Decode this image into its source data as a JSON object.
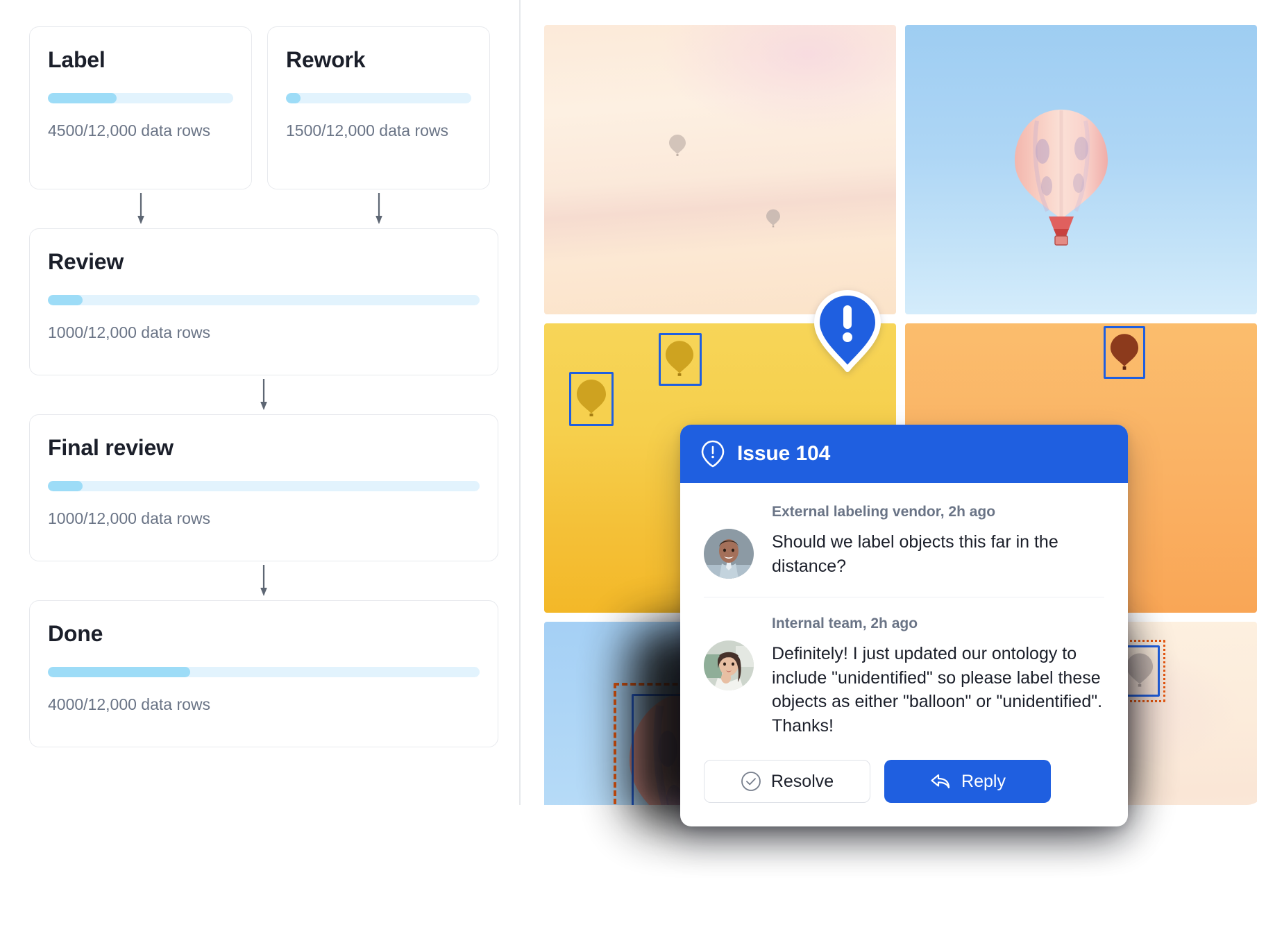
{
  "workflow": {
    "stages": [
      {
        "id": "label",
        "title": "Label",
        "completed": 4500,
        "total": "12,000",
        "progress_pct": 37,
        "rows_label": "4500/12,000 data rows"
      },
      {
        "id": "rework",
        "title": "Rework",
        "completed": 1500,
        "total": "12,000",
        "progress_pct": 8,
        "rows_label": "1500/12,000 data rows"
      },
      {
        "id": "review",
        "title": "Review",
        "completed": 1000,
        "total": "12,000",
        "progress_pct": 8,
        "rows_label": "1000/12,000 data rows"
      },
      {
        "id": "final-review",
        "title": "Final review",
        "completed": 1000,
        "total": "12,000",
        "progress_pct": 8,
        "rows_label": "1000/12,000 data rows"
      },
      {
        "id": "done",
        "title": "Done",
        "completed": 4000,
        "total": "12,000",
        "progress_pct": 33,
        "rows_label": "4000/12,000 data rows"
      }
    ],
    "arrow_icon": "arrow-down-icon"
  },
  "gallery": {
    "tiles": [
      {
        "id": "tile-1",
        "description": "pale peach sunrise sky with two distant hot air balloons",
        "annotations": 0
      },
      {
        "id": "tile-2",
        "description": "light blue sky with pink and white striped hot air balloon",
        "annotations": 0
      },
      {
        "id": "tile-3",
        "description": "golden yellow sky with silhouetted balloons",
        "annotations": 2
      },
      {
        "id": "tile-4",
        "description": "orange sky with dark red hot air balloon",
        "annotations": 1
      },
      {
        "id": "tile-5",
        "description": "blue sky with large pink striped hot air balloon",
        "annotations": 2
      },
      {
        "id": "tile-6",
        "description": "cream sky with faint distant balloons",
        "annotations": 4
      }
    ],
    "box_color": "#1f5fe0",
    "dashed_box_color": "#e8570f"
  },
  "pin": {
    "icon": "issue-pin-exclamation-icon",
    "color": "#1f5fe0"
  },
  "dialog": {
    "icon": "issue-pin-icon",
    "title": "Issue 104",
    "accent_color": "#1f5fe0",
    "comments": [
      {
        "author_meta": "External labeling vendor, 2h ago",
        "avatar": "avatar-external-vendor",
        "text": "Should we label objects this far in the distance?"
      },
      {
        "author_meta": "Internal team, 2h ago",
        "avatar": "avatar-internal-team",
        "text": "Definitely! I just updated our ontology to include \"unidentified\" so please label these objects as either \"balloon\" or \"unidentified\". Thanks!"
      }
    ],
    "actions": {
      "resolve_label": "Resolve",
      "resolve_icon": "check-circle-icon",
      "reply_label": "Reply",
      "reply_icon": "reply-arrow-icon"
    }
  }
}
